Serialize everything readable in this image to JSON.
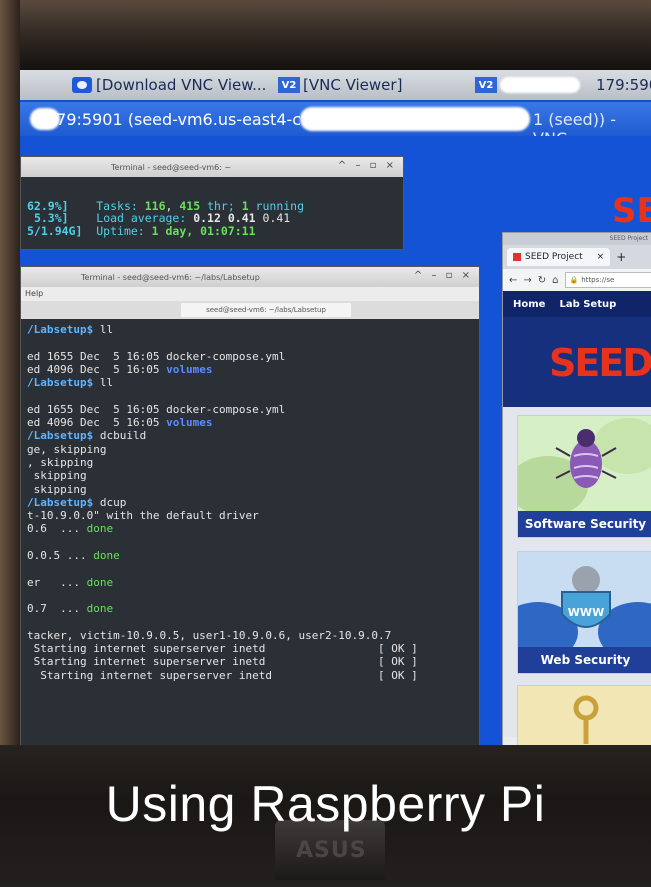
{
  "taskbar": {
    "items": [
      {
        "label": "[Download VNC View..."
      },
      {
        "label": "[VNC Viewer]"
      },
      {
        "label": "179:590"
      }
    ]
  },
  "vnc_window": {
    "title_left": "179:5901 (seed-vm6.us-east4-c.",
    "title_right": "1 (seed)) - VNC"
  },
  "top_terminal": {
    "title": "Terminal - seed@seed-vm6: ~",
    "lines": [
      {
        "left": "62.9%]",
        "label": "Tasks: ",
        "a": "116",
        "sep": ", ",
        "b": "415",
        "rest": " thr; ",
        "c": "1",
        "tail": " running"
      },
      {
        "left": "5.3%]",
        "label": "Load average: ",
        "a": "0.12",
        "sep": " ",
        "b": "0.41",
        "rest": " 0.41",
        "c": "",
        "tail": ""
      },
      {
        "left": "5/1.94G]",
        "label": "Uptime: ",
        "a": "1 day, 01:07:11",
        "sep": "",
        "b": "",
        "rest": "",
        "c": "",
        "tail": ""
      }
    ]
  },
  "main_terminal": {
    "title": "Terminal - seed@seed-vm6: ~/labs/Labsetup",
    "menu": "Help",
    "tab": "seed@seed-vm6: ~/labs/Labsetup",
    "lines": [
      "/Labsetup$ ll",
      "",
      "ed 1655 Dec  5 16:05 docker-compose.yml",
      "ed 4096 Dec  5 16:05 volumes",
      "/Labsetup$ ll",
      "",
      "ed 1655 Dec  5 16:05 docker-compose.yml",
      "ed 4096 Dec  5 16:05 volumes",
      "/Labsetup$ dcbuild",
      "ge, skipping",
      ", skipping",
      " skipping",
      " skipping",
      "/Labsetup$ dcup",
      "t-10.9.0.0\" with the default driver",
      "0.6  ... done",
      "",
      "0.0.5 ... done",
      "",
      "er   ... done",
      "",
      "0.7  ... done",
      "",
      "tacker, victim-10.9.0.5, user1-10.9.0.6, user2-10.9.0.7",
      " Starting internet superserver inetd                 [ OK ]",
      " Starting internet superserver inetd                 [ OK ]",
      "  Starting internet superserver inetd                [ OK ]"
    ]
  },
  "browser": {
    "window_title": "SEED Project",
    "tab_label": "SEED Project",
    "url": "https://se",
    "nav": [
      "Home",
      "Lab Setup"
    ],
    "logo": "SEED",
    "cards": [
      {
        "label": "Software Security"
      },
      {
        "label": "Web Security"
      }
    ]
  },
  "desktop_logo": "SE",
  "caption": "Using Raspberry Pi",
  "brand": "ASUS",
  "colors": {
    "desktop": "#1553d6",
    "seed_red": "#e8331c",
    "card_label": "#1f3f99",
    "terminal_bg": "#2b2f36"
  }
}
